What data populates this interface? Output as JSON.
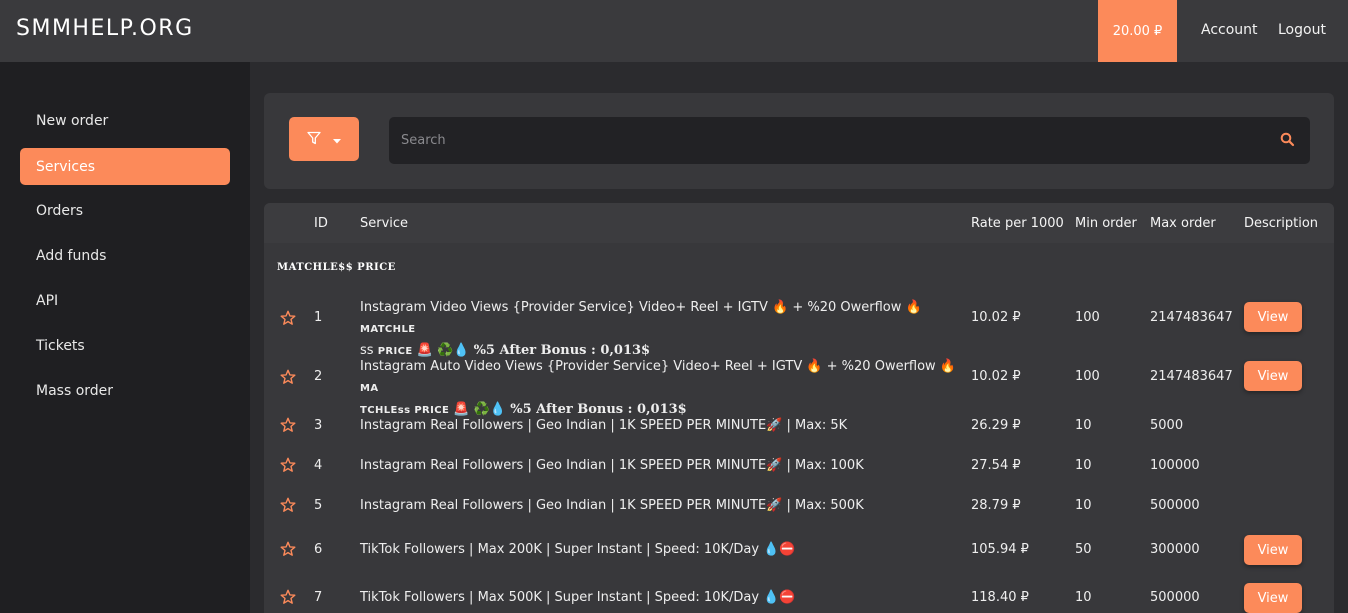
{
  "header": {
    "logo": "SMMHELP.ORG",
    "balance": "20.00 ₽",
    "account": "Account",
    "logout": "Logout"
  },
  "sidebar": {
    "items": [
      {
        "label": "New order",
        "active": false
      },
      {
        "label": "Services",
        "active": true
      },
      {
        "label": "Orders",
        "active": false
      },
      {
        "label": "Add funds",
        "active": false
      },
      {
        "label": "API",
        "active": false
      },
      {
        "label": "Tickets",
        "active": false
      },
      {
        "label": "Mass order",
        "active": false
      }
    ]
  },
  "filter": {
    "search_placeholder": "Search",
    "filter_icon": "funnel-icon",
    "dropdown_icon": "caret-down-icon",
    "search_icon": "magnifier-icon"
  },
  "table": {
    "columns": {
      "id": "ID",
      "service": "Service",
      "rate": "Rate per 1000",
      "min": "Min order",
      "max": "Max order",
      "description": "Description"
    },
    "category": "MATCHLE$$ PRICE",
    "view_label": "View",
    "rows": [
      {
        "id": "1",
        "service_line1": "Instagram Video Views {Provider Service} Video+ Reel + IGTV 🔥 + %20 Owerflow 🔥",
        "service_caps1": "MATCHLE",
        "service_line2a": "ss ",
        "service_caps2": "PRICE",
        "service_emoji2": " 🚨 ♻️💧 ",
        "service_bold2": "%5 After Bonus : 0,013$",
        "rate": "10.02 ₽",
        "min": "100",
        "max": "2147483647",
        "has_view": true
      },
      {
        "id": "2",
        "service_line1": "Instagram Auto Video Views {Provider Service} Video+ Reel + IGTV 🔥 + %20 Owerflow 🔥",
        "service_caps1": "MA",
        "service_line2a": "",
        "service_caps2": "TCHLEss PRICE",
        "service_emoji2": " 🚨 ♻️💧 ",
        "service_bold2": "%5 After Bonus : 0,013$",
        "rate": "10.02 ₽",
        "min": "100",
        "max": "2147483647",
        "has_view": true
      },
      {
        "id": "3",
        "service": "Instagram Real Followers | Geo Indian | 1K SPEED PER MINUTE🚀 | Max: 5K",
        "rate": "26.29 ₽",
        "min": "10",
        "max": "5000",
        "has_view": false
      },
      {
        "id": "4",
        "service": "Instagram Real Followers | Geo Indian | 1K SPEED PER MINUTE🚀 | Max: 100K",
        "rate": "27.54 ₽",
        "min": "10",
        "max": "100000",
        "has_view": false
      },
      {
        "id": "5",
        "service": "Instagram Real Followers | Geo Indian | 1K SPEED PER MINUTE🚀 | Max: 500K",
        "rate": "28.79 ₽",
        "min": "10",
        "max": "500000",
        "has_view": false
      },
      {
        "id": "6",
        "service": "TikTok Followers | Max 200K | Super Instant | Speed: 10K/Day 💧⛔",
        "rate": "105.94 ₽",
        "min": "50",
        "max": "300000",
        "has_view": true
      },
      {
        "id": "7",
        "service": "TikTok Followers | Max 500K | Super Instant | Speed: 10K/Day 💧⛔",
        "rate": "118.40 ₽",
        "min": "10",
        "max": "500000",
        "has_view": true
      }
    ]
  },
  "colors": {
    "accent": "#fc8a5a",
    "header_bg": "#3a3a3d",
    "sidebar_bg": "#1f1f22",
    "panel_bg": "#38383b",
    "page_bg": "#2b2b2e"
  }
}
